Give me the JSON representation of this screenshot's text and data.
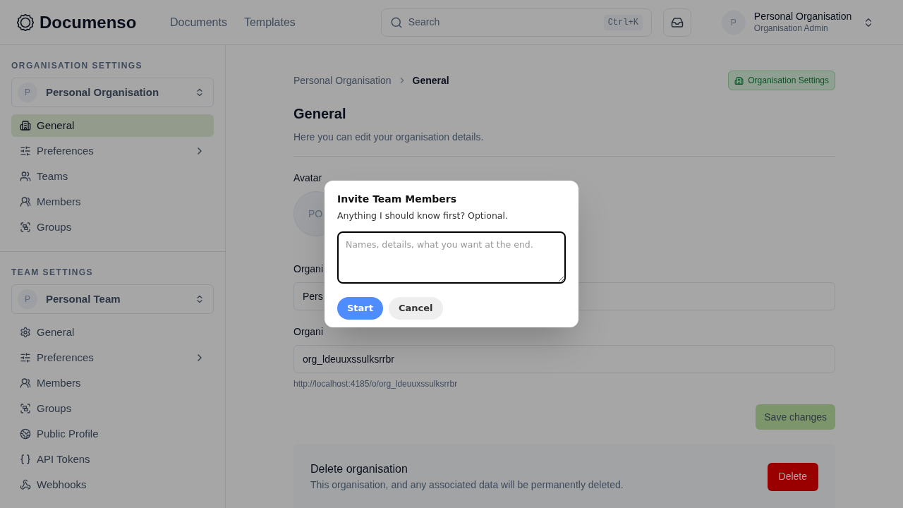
{
  "header": {
    "logo": "Documenso",
    "nav": [
      {
        "label": "Documents",
        "selected": false
      },
      {
        "label": "Templates",
        "selected": false
      }
    ],
    "search": {
      "placeholder": "Search",
      "shortcut": "Ctrl+K"
    },
    "account": {
      "initial": "P",
      "name": "Personal Organisation",
      "role": "Organisation Admin"
    }
  },
  "sidebar": [
    {
      "heading": "ORGANISATION SETTINGS",
      "selector": {
        "initial": "P",
        "name": "Personal Organisation"
      },
      "items": [
        {
          "label": "General",
          "selected": true,
          "submenu": false
        },
        {
          "label": "Preferences",
          "selected": false,
          "submenu": true
        },
        {
          "label": "Teams",
          "selected": false,
          "submenu": false
        },
        {
          "label": "Members",
          "selected": false,
          "submenu": false
        },
        {
          "label": "Groups",
          "selected": false,
          "submenu": false
        }
      ]
    },
    {
      "heading": "TEAM SETTINGS",
      "selector": {
        "initial": "P",
        "name": "Personal Team"
      },
      "items": [
        {
          "label": "General",
          "selected": false,
          "submenu": false
        },
        {
          "label": "Preferences",
          "selected": false,
          "submenu": true
        },
        {
          "label": "Members",
          "selected": false,
          "submenu": false
        },
        {
          "label": "Groups",
          "selected": false,
          "submenu": false
        },
        {
          "label": "Public Profile",
          "selected": false,
          "submenu": false
        },
        {
          "label": "API Tokens",
          "selected": false,
          "submenu": false
        },
        {
          "label": "Webhooks",
          "selected": false,
          "submenu": false
        }
      ]
    }
  ],
  "main": {
    "breadcrumb": [
      "Personal Organisation",
      "General"
    ],
    "badge": "Organisation Settings",
    "title": "General",
    "subtitle": "Here you can edit your organisation details.",
    "avatar": {
      "label": "Avatar",
      "initials": "PO"
    },
    "fields": [
      {
        "label": "Organi",
        "value": "Pers"
      },
      {
        "label": "Organi",
        "value": "org_ldeuuxssulksrrbr",
        "hint": "http://localhost:4185/o/org_ldeuuxssulksrrbr"
      }
    ],
    "save": "Save changes",
    "danger": {
      "title": "Delete organisation",
      "text": "This organisation, and any associated data will be permanently deleted.",
      "button": "Delete"
    }
  },
  "dialog": {
    "title": "Invite Team Members",
    "subtitle": "Anything I should know first? Optional.",
    "placeholder": "Names, details, what you want at the end.",
    "buttons": [
      "Start",
      "Cancel"
    ]
  }
}
